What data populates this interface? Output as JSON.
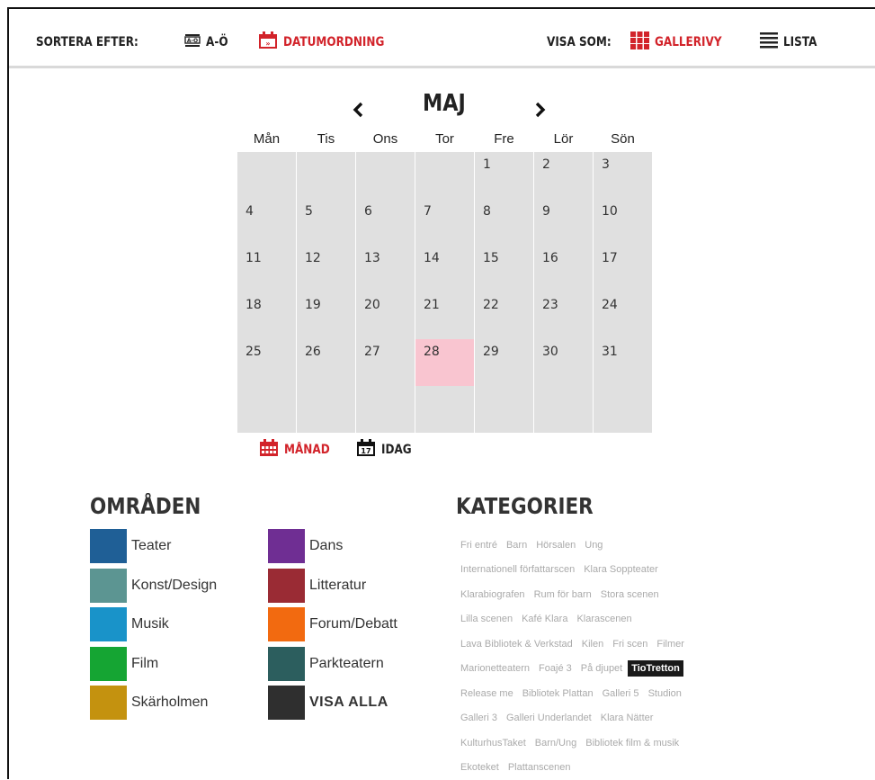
{
  "sort": {
    "label": "SORTERA EFTER:",
    "az": "A-Ö",
    "az_icon": "az-sort-icon",
    "date": "DATUMORDNING",
    "date_icon": "date-order-icon"
  },
  "view": {
    "label": "VISA SOM:",
    "gallery": "GALLERIVY",
    "gallery_icon": "grid-icon",
    "list": "LISTA",
    "list_icon": "list-icon"
  },
  "calendar": {
    "prev": "‹",
    "next": "›",
    "month": "MAJ",
    "weekdays": [
      "Mån",
      "Tis",
      "Ons",
      "Tor",
      "Fre",
      "Lör",
      "Sön"
    ],
    "days": [
      "",
      "",
      "",
      "",
      "1",
      "2",
      "3",
      "4",
      "5",
      "6",
      "7",
      "8",
      "9",
      "10",
      "11",
      "12",
      "13",
      "14",
      "15",
      "16",
      "17",
      "18",
      "19",
      "20",
      "21",
      "22",
      "23",
      "24",
      "25",
      "26",
      "27",
      "28",
      "29",
      "30",
      "31",
      "",
      "",
      "",
      "",
      "",
      "",
      ""
    ],
    "today": "28",
    "month_btn": "MÅNAD",
    "today_btn": "IDAG",
    "today_icon_num": "17"
  },
  "areas": {
    "title": "OMRÅDEN",
    "items": [
      {
        "label": "Teater",
        "color": "#1f5f96"
      },
      {
        "label": "Konst/Design",
        "color": "#5c9592"
      },
      {
        "label": "Musik",
        "color": "#1993c9"
      },
      {
        "label": "Film",
        "color": "#15a533"
      },
      {
        "label": "Skärholmen",
        "color": "#c4920f"
      },
      {
        "label": "Dans",
        "color": "#6f2e93"
      },
      {
        "label": "Litteratur",
        "color": "#9a2b34"
      },
      {
        "label": "Forum/Debatt",
        "color": "#f26a10"
      },
      {
        "label": "Parkteatern",
        "color": "#2c5e5e"
      },
      {
        "label": "VISA ALLA",
        "color": "#2f2f2f"
      }
    ]
  },
  "categories": {
    "title": "KATEGORIER",
    "active": "TioTretton",
    "lines": [
      [
        "Fri entré",
        "Barn",
        "Hörsalen",
        "Ung"
      ],
      [
        "Internationell författarscen",
        "Klara Soppteater"
      ],
      [
        "Klarabiografen",
        "Rum för barn",
        "Stora scenen"
      ],
      [
        "Lilla scenen",
        "Kafé Klara",
        "Klarascenen"
      ],
      [
        "Lava Bibliotek & Verkstad",
        "Kilen",
        "Fri scen",
        "Filmer"
      ],
      [
        "Marionetteatern",
        "Foajé 3",
        "På djupet",
        "TioTretton"
      ],
      [
        "Release me",
        "Bibliotek Plattan",
        "Galleri 5",
        "Studion"
      ],
      [
        "Galleri 3",
        "Galleri Underlandet",
        "Klara Nätter"
      ],
      [
        "KulturhusTaket",
        "Barn/Ung",
        "Bibliotek film & musik"
      ],
      [
        "Ekoteket",
        "Plattanscenen"
      ]
    ]
  },
  "colors": {
    "accent": "#d2232a",
    "cell": "#e0e0e0",
    "today": "#f9c5d0"
  }
}
